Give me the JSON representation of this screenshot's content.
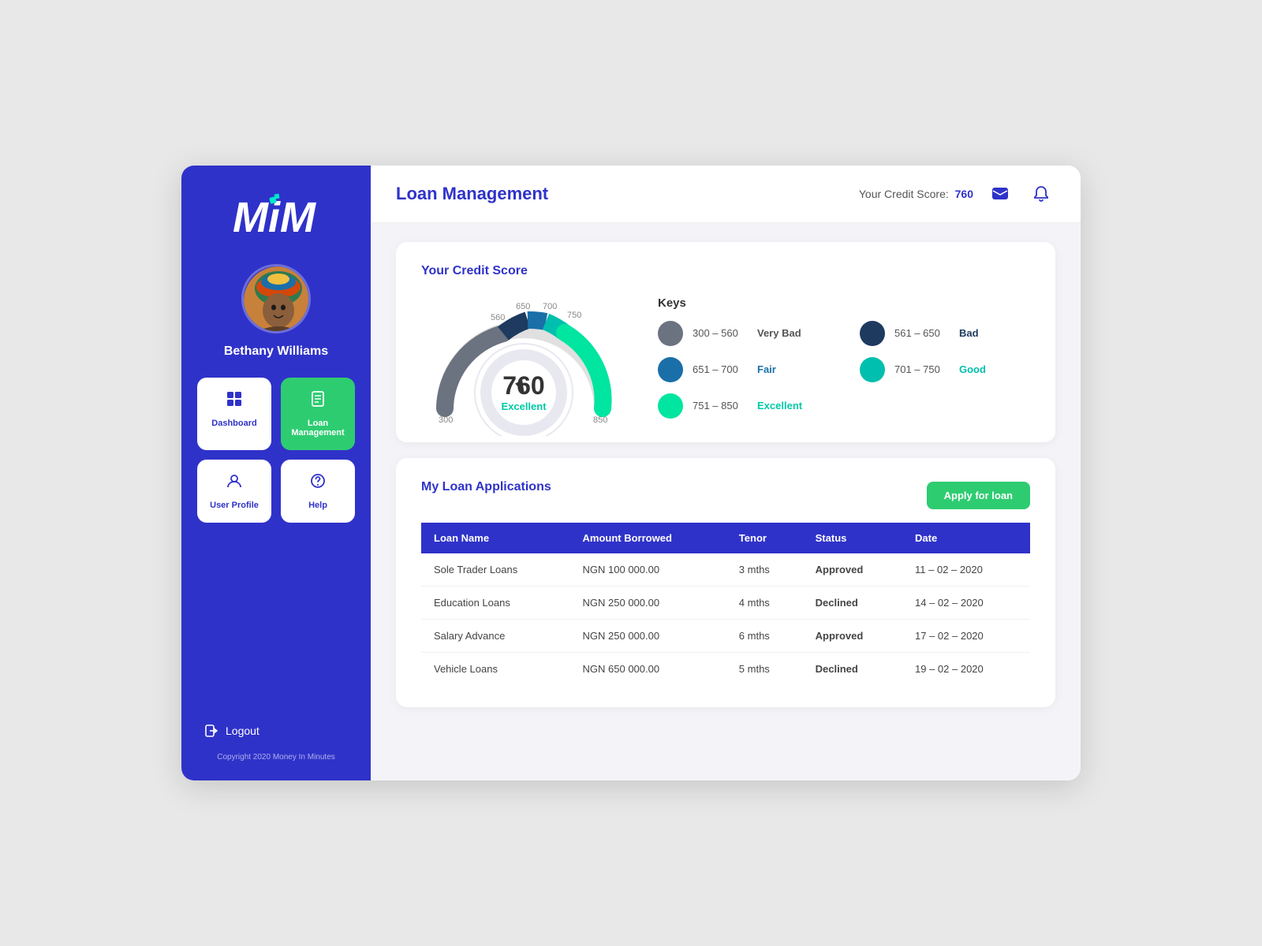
{
  "app": {
    "logo": "MiM",
    "copyright": "Copyright 2020 Money In Minutes"
  },
  "sidebar": {
    "user_name": "Bethany Williams",
    "nav_items": [
      {
        "id": "dashboard",
        "label": "Dashboard",
        "icon": "⊞",
        "active": false
      },
      {
        "id": "loan-management",
        "label": "Loan Management",
        "icon": "📄",
        "active": true
      },
      {
        "id": "user-profile",
        "label": "User Profile",
        "icon": "👤",
        "active": false
      },
      {
        "id": "help",
        "label": "Help",
        "icon": "❓",
        "active": false
      }
    ],
    "logout_label": "Logout"
  },
  "header": {
    "page_title": "Loan Management",
    "credit_score_label": "Your Credit Score:",
    "credit_score_value": "760"
  },
  "credit_score_card": {
    "title": "Your Credit Score",
    "score": "760",
    "score_label": "Excellent",
    "keys_title": "Keys",
    "keys": [
      {
        "range": "300 – 560",
        "desc": "Very Bad",
        "color": "#6B7280",
        "desc_color": "#555"
      },
      {
        "range": "561 – 650",
        "desc": "Bad",
        "color": "#1E3A5F",
        "desc_color": "#1E3A5F"
      },
      {
        "range": "651 – 700",
        "desc": "Fair",
        "color": "#1A6FA8",
        "desc_color": "#1A6FA8"
      },
      {
        "range": "701 – 750",
        "desc": "Good",
        "color": "#00C9B1",
        "desc_color": "#00C9B1"
      },
      {
        "range": "751 – 850",
        "desc": "Excellent",
        "color": "#00E5A0",
        "desc_color": "#00E5A0"
      }
    ]
  },
  "loan_applications": {
    "section_title": "My Loan Applications",
    "apply_button": "Apply for loan",
    "columns": [
      "Loan Name",
      "Amount Borrowed",
      "Tenor",
      "Status",
      "Date"
    ],
    "rows": [
      {
        "name": "Sole Trader Loans",
        "amount": "NGN 100 000.00",
        "tenor": "3 mths",
        "status": "Approved",
        "status_type": "approved",
        "date": "11 – 02 – 2020"
      },
      {
        "name": "Education Loans",
        "amount": "NGN 250 000.00",
        "tenor": "4 mths",
        "status": "Declined",
        "status_type": "declined",
        "date": "14 – 02 – 2020"
      },
      {
        "name": "Salary Advance",
        "amount": "NGN 250 000.00",
        "tenor": "6 mths",
        "status": "Approved",
        "status_type": "approved",
        "date": "17 – 02 – 2020"
      },
      {
        "name": "Vehicle Loans",
        "amount": "NGN 650 000.00",
        "tenor": "5 mths",
        "status": "Declined",
        "status_type": "declined",
        "date": "19 – 02 – 2020"
      }
    ]
  }
}
